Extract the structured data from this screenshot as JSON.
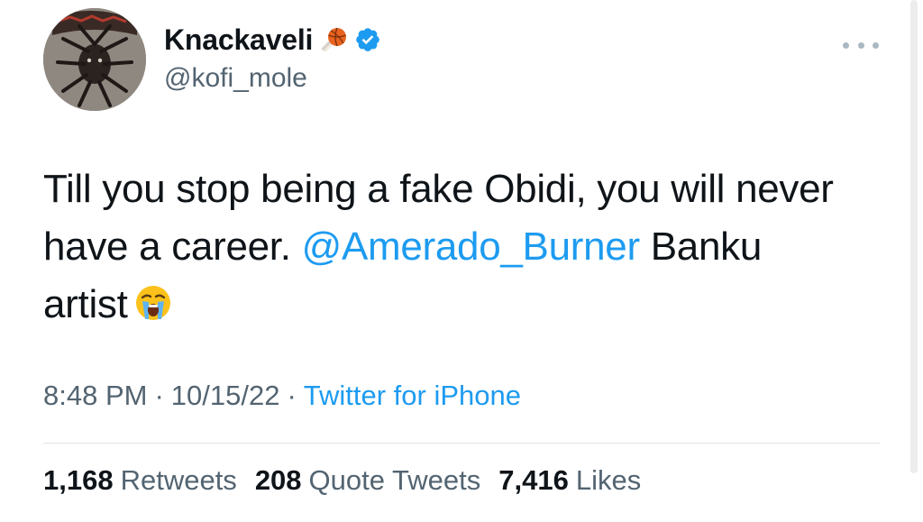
{
  "author": {
    "display_name": "Knackaveli",
    "handle": "@kofi_mole"
  },
  "tweet": {
    "text_part1": "Till you stop being a fake Obidi, you will never have a career. ",
    "mention": "@Amerado_Burner",
    "text_part2": " Banku artist"
  },
  "meta": {
    "time": "8:48 PM",
    "separator": "·",
    "date": "10/15/22",
    "source": "Twitter for iPhone"
  },
  "stats": {
    "retweets_count": "1,168",
    "retweets_label": "Retweets",
    "quotes_count": "208",
    "quotes_label": "Quote Tweets",
    "likes_count": "7,416",
    "likes_label": "Likes"
  },
  "icons": {
    "more": "more-options-icon",
    "verified": "verified-badge-icon",
    "name_emoji": "basketball-emoji-icon",
    "text_emoji": "loudly-crying-face-emoji-icon"
  },
  "colors": {
    "link": "#1d9bf0",
    "secondary_text": "#536471",
    "primary_text": "#0f1419"
  }
}
